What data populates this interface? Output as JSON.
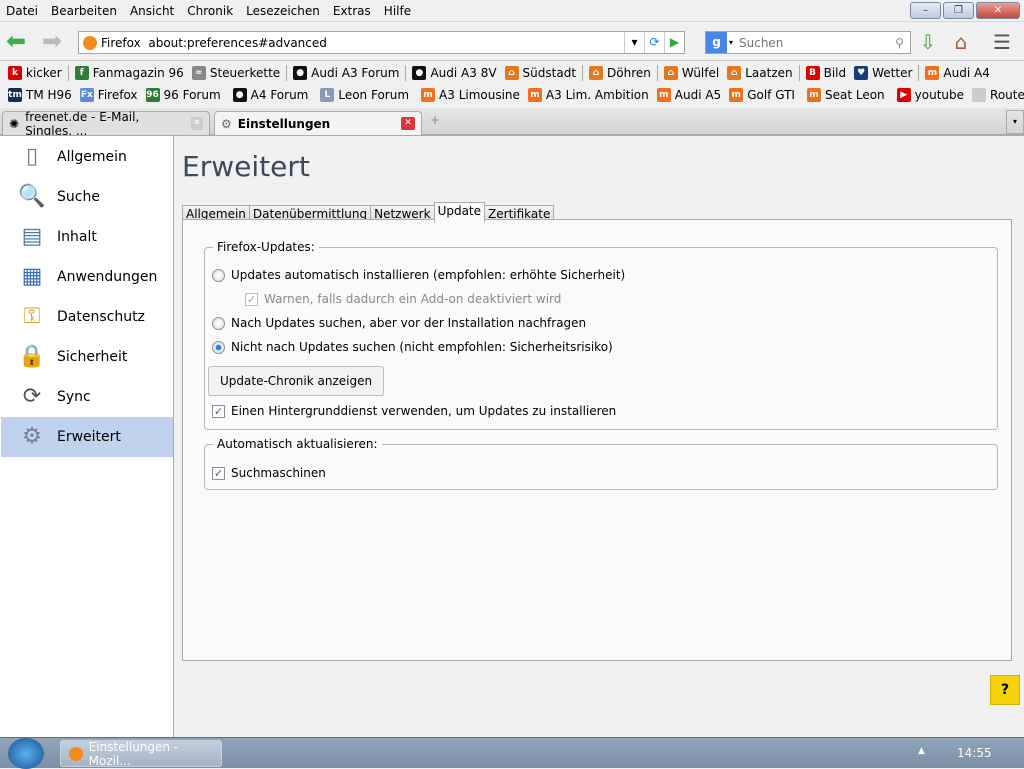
{
  "menubar": [
    "Datei",
    "Bearbeiten",
    "Ansicht",
    "Chronik",
    "Lesezeichen",
    "Extras",
    "Hilfe"
  ],
  "window_controls": {
    "minimize": "–",
    "restore": "❐",
    "close": "✕"
  },
  "urlbar": {
    "identity": "Firefox",
    "url": "about:preferences#advanced"
  },
  "search": {
    "engine": "g",
    "placeholder": "Suchen"
  },
  "bookmarks_row1": [
    {
      "label": "kicker",
      "icon": "#d00",
      "glyph": "k",
      "sep": true
    },
    {
      "label": "Fanmagazin 96",
      "icon": "#2e7d32",
      "glyph": "f",
      "sep": false
    },
    {
      "label": "Steuerkette",
      "icon": "#888",
      "glyph": "≈",
      "sep": true
    },
    {
      "label": "Audi A3 Forum",
      "icon": "#111",
      "glyph": "●",
      "sep": true
    },
    {
      "label": "Audi A3 8V",
      "icon": "#111",
      "glyph": "●",
      "sep": false
    },
    {
      "label": "Südstadt",
      "icon": "#e07a1a",
      "glyph": "⌂",
      "sep": true
    },
    {
      "label": "Döhren",
      "icon": "#e07a1a",
      "glyph": "⌂",
      "sep": true
    },
    {
      "label": "Wülfel",
      "icon": "#e07a1a",
      "glyph": "⌂",
      "sep": false
    },
    {
      "label": "Laatzen",
      "icon": "#e07a1a",
      "glyph": "⌂",
      "sep": true
    },
    {
      "label": "Bild",
      "icon": "#d00",
      "glyph": "B",
      "sep": false
    },
    {
      "label": "Wetter",
      "icon": "#1a3a7a",
      "glyph": "♥",
      "sep": true
    },
    {
      "label": "Audi A4",
      "icon": "#f07020",
      "glyph": "m",
      "sep": false
    }
  ],
  "bookmarks_row2": [
    {
      "label": "TM H96",
      "icon": "#1a2a5a",
      "glyph": "tm",
      "sep": false
    },
    {
      "label": "Firefox",
      "icon": "#5a8fd8",
      "glyph": "Fx",
      "sep": false
    },
    {
      "label": "96 Forum",
      "icon": "#2e7d32",
      "glyph": "96",
      "sep": true
    },
    {
      "label": "A4 Forum",
      "icon": "#111",
      "glyph": "●",
      "sep": true
    },
    {
      "label": "Leon Forum",
      "icon": "#8899bb",
      "glyph": "L",
      "sep": true
    },
    {
      "label": "A3 Limousine",
      "icon": "#f07020",
      "glyph": "m",
      "sep": false
    },
    {
      "label": "A3 Lim. Ambition",
      "icon": "#f07020",
      "glyph": "m",
      "sep": false
    },
    {
      "label": "Audi A5",
      "icon": "#f07020",
      "glyph": "m",
      "sep": false
    },
    {
      "label": "Golf GTI",
      "icon": "#f07020",
      "glyph": "m",
      "sep": true
    },
    {
      "label": "Seat Leon",
      "icon": "#f07020",
      "glyph": "m",
      "sep": true
    },
    {
      "label": "youtube",
      "icon": "#d00",
      "glyph": "▶",
      "sep": false
    },
    {
      "label": "Route",
      "icon": "#ccc",
      "glyph": "",
      "sep": false
    }
  ],
  "tabs": [
    {
      "label": "freenet.de - E-Mail, Singles, ...",
      "active": false
    },
    {
      "label": "Einstellungen",
      "active": true
    }
  ],
  "new_tab": "+",
  "sidebar": [
    {
      "label": "Allgemein",
      "icon": "switch-icon",
      "glyph": "▯",
      "color": "#6a7a90"
    },
    {
      "label": "Suche",
      "icon": "magnifier-icon",
      "glyph": "🔍",
      "color": "#5a8ad0"
    },
    {
      "label": "Inhalt",
      "icon": "content-icon",
      "glyph": "▤",
      "color": "#4a7ab0"
    },
    {
      "label": "Anwendungen",
      "icon": "applications-icon",
      "glyph": "▦",
      "color": "#3a70c0"
    },
    {
      "label": "Datenschutz",
      "icon": "privacy-icon",
      "glyph": "⚿",
      "color": "#d8a020"
    },
    {
      "label": "Sicherheit",
      "icon": "lock-icon",
      "glyph": "🔒",
      "color": "#777"
    },
    {
      "label": "Sync",
      "icon": "sync-icon",
      "glyph": "⟳",
      "color": "#555"
    },
    {
      "label": "Erweitert",
      "icon": "gear-icon",
      "glyph": "⚙",
      "color": "#7a7a9a",
      "selected": true
    }
  ],
  "page": {
    "title": "Erweitert",
    "tabs": [
      "Allgemein",
      "Datenübermittlung",
      "Netzwerk",
      "Update",
      "Zertifikate"
    ],
    "active_tab": "Update",
    "firefox_updates": {
      "legend": "Firefox-Updates:",
      "opt_auto": "Updates automatisch installieren (empfohlen: erhöhte Sicherheit)",
      "warn_addon": "Warnen, falls dadurch ein Add-on deaktiviert wird",
      "opt_ask": "Nach Updates suchen, aber vor der Installation nachfragen",
      "opt_never": "Nicht nach Updates suchen (nicht empfohlen: Sicherheitsrisiko)",
      "selected": "opt_never",
      "history_button": "Update-Chronik anzeigen",
      "background_service": "Einen Hintergrunddienst verwenden, um Updates zu installieren",
      "background_service_checked": true,
      "warn_addon_checked": true
    },
    "auto_update": {
      "legend": "Automatisch aktualisieren:",
      "search_engines": "Suchmaschinen",
      "search_engines_checked": true
    },
    "help": "?"
  },
  "taskbar": {
    "task": "Einstellungen - Mozil...",
    "clock": "14:55",
    "tray": "▲"
  }
}
